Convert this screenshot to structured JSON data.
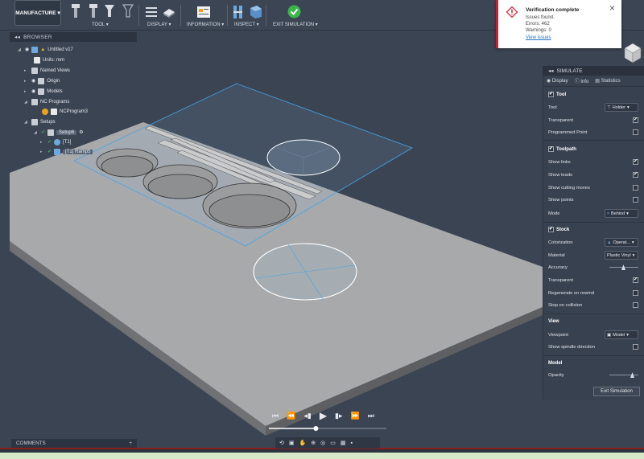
{
  "toolbar": {
    "workspace": "MANUFACTURE",
    "groups": [
      {
        "label": "TOOL",
        "caret": "▾"
      },
      {
        "label": "DISPLAY",
        "caret": "▾"
      },
      {
        "label": "INFORMATION",
        "caret": "▾"
      },
      {
        "label": "INSPECT",
        "caret": "▾"
      },
      {
        "label": "EXIT SIMULATION",
        "caret": "▾"
      }
    ]
  },
  "browser": {
    "title": "BROWSER",
    "items": [
      {
        "label": "Untitled v17"
      },
      {
        "label": "Units: mm"
      },
      {
        "label": "Named Views"
      },
      {
        "label": "Origin"
      },
      {
        "label": "Models"
      },
      {
        "label": "NC Programs"
      },
      {
        "label": "NCProgram3"
      },
      {
        "label": "Setups"
      },
      {
        "label": "Setup6"
      },
      {
        "label": "[T1]"
      },
      {
        "label": "[T1] Ramp5"
      }
    ]
  },
  "notification": {
    "title": "Verification complete",
    "line1": "Issues found.",
    "line2": "Errors: 462",
    "line3": "Warnings: 0",
    "link": "View issues",
    "close": "×"
  },
  "simulate": {
    "title": "SIMULATE",
    "tabs": [
      "Display",
      "Info",
      "Statistics"
    ],
    "tool": {
      "title": "Tool",
      "tool_label": "Tool",
      "tool_value": "Holder",
      "transparent": "Transparent",
      "programmed_point": "Programmed Point"
    },
    "toolpath": {
      "title": "Toolpath",
      "show_links": "Show links",
      "show_leads": "Show leads",
      "show_cutting_moves": "Show cutting moves",
      "show_points": "Show points",
      "mode_label": "Mode",
      "mode_value": "Behind"
    },
    "stock": {
      "title": "Stock",
      "colorization_label": "Colorization",
      "colorization_value": "Operat...",
      "material_label": "Material",
      "material_value": "Plastic Vinyl",
      "accuracy": "Accuracy",
      "transparent": "Transparent",
      "regenerate": "Regenerate on rewind",
      "stop_on_collision": "Stop on collision"
    },
    "view": {
      "title": "View",
      "viewpoint_label": "Viewpoint",
      "viewpoint_value": "Model",
      "spindle": "Show spindle direction"
    },
    "model": {
      "title": "Model",
      "opacity": "Opacity"
    },
    "exit_button": "Exit Simulation"
  },
  "comments": {
    "title": "COMMENTS",
    "add": "+"
  },
  "playback": {
    "progress": 0.4
  }
}
